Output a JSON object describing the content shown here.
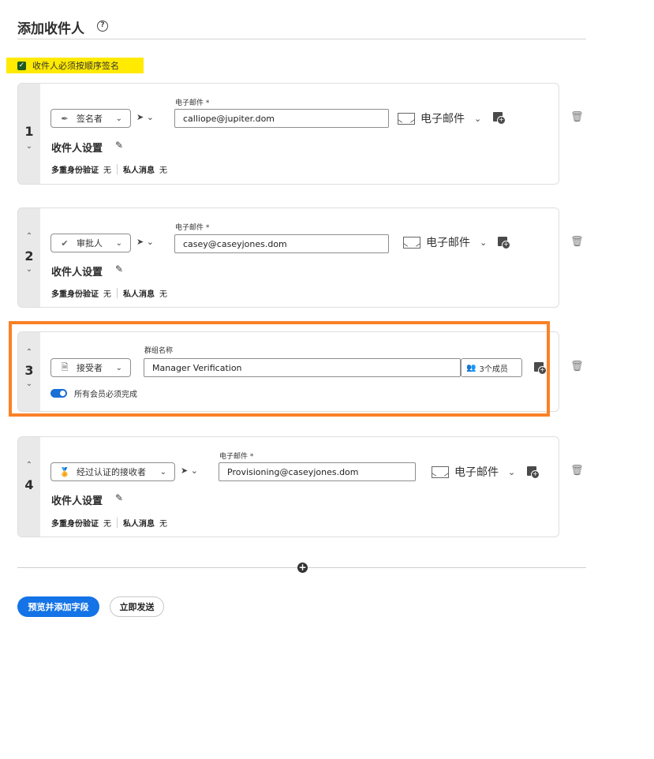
{
  "header": {
    "title": "添加收件人",
    "help_icon": "?"
  },
  "sequence": {
    "checked": true,
    "label": "收件人必须按顺序签名"
  },
  "recipients": [
    {
      "number": "1",
      "role": "签名者",
      "role_icon": "pen-icon",
      "email_label": "电子邮件 *",
      "email": "calliope@jupiter.dom",
      "auth_method": "电子邮件",
      "settings_label": "收件人设置",
      "mfa_key": "多重身份验证",
      "mfa_value": "无",
      "message_key": "私人消息",
      "message_value": "无"
    },
    {
      "number": "2",
      "role": "审批人",
      "role_icon": "check-circle-icon",
      "email_label": "电子邮件 *",
      "email": "casey@caseyjones.dom",
      "auth_method": "电子邮件",
      "settings_label": "收件人设置",
      "mfa_key": "多重身份验证",
      "mfa_value": "无",
      "message_key": "私人消息",
      "message_value": "无"
    },
    {
      "number": "3",
      "role": "接受者",
      "role_icon": "document-icon",
      "group_label": "群组名称",
      "group_name": "Manager Verification",
      "members": "3个成员",
      "toggle_label": "所有会员必须完成",
      "toggle_on": true
    },
    {
      "number": "4",
      "role": "经过认证的接收者",
      "role_icon": "certificate-icon",
      "email_label": "电子邮件 *",
      "email": "Provisioning@caseyjones.dom",
      "auth_method": "电子邮件",
      "settings_label": "收件人设置",
      "mfa_key": "多重身份验证",
      "mfa_value": "无",
      "message_key": "私人消息",
      "message_value": "无"
    }
  ],
  "footer": {
    "primary_button": "预览并添加字段",
    "secondary_button": "立即发送"
  },
  "colors": {
    "accent": "#1473e6",
    "highlight_border": "#fb8126",
    "sequence_highlight": "#ffea00"
  }
}
